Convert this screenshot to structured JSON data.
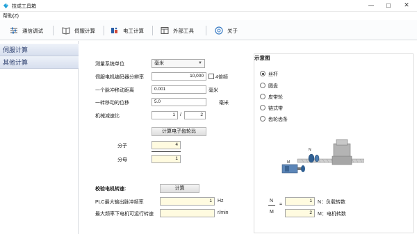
{
  "window": {
    "title": "技成工具箱",
    "min_glyph": "—",
    "max_glyph": "☐",
    "close_glyph": "✕"
  },
  "menu": {
    "help": "帮助(Z)"
  },
  "toolbar": {
    "items": [
      {
        "label": "通信调试",
        "icon": "sliders-icon"
      },
      {
        "label": "伺服计算",
        "icon": "book-icon"
      },
      {
        "label": "电工计算",
        "icon": "electrician-icon"
      },
      {
        "label": "外部工具",
        "icon": "window-tools-icon"
      },
      {
        "label": "关于",
        "icon": "about-icon"
      }
    ]
  },
  "sidebar": {
    "items": [
      {
        "label": "伺服计算"
      },
      {
        "label": "其他计算"
      }
    ]
  },
  "form": {
    "unit_label": "测量系统单位",
    "unit_value": "毫米",
    "encoder_label": "伺服电机编码器分辨率",
    "encoder_value": "10,000",
    "quad_label": "4倍频",
    "pulse_move_label": "一个脉冲移动距离",
    "pulse_move_value": "0.001",
    "pulse_move_unit": "毫米",
    "turn_move_label": "一转移动的位移",
    "turn_move_value": "5.0",
    "turn_move_unit": "毫米",
    "reduction_label": "机械减速比",
    "reduction_num": "1",
    "reduction_slash": "/",
    "reduction_den": "2",
    "gear_button": "计算电子齿轮比",
    "numerator_label": "分子",
    "numerator_value": "4",
    "denominator_label": "分母",
    "denominator_value": "1"
  },
  "speed": {
    "title": "校验电机转速:",
    "calc_button": "计算",
    "plc_label": "PLC最大输出脉冲频率",
    "plc_value": "1",
    "plc_unit": "Hz",
    "max_speed_label": "最大频率下电机可运行转速",
    "max_speed_value": "",
    "max_speed_unit": "r/min"
  },
  "diagram": {
    "title": "示意图",
    "options": [
      {
        "label": "丝杆",
        "selected": true
      },
      {
        "label": "圆盘",
        "selected": false
      },
      {
        "label": "皮带轮",
        "selected": false
      },
      {
        "label": "链式带",
        "selected": false
      },
      {
        "label": "齿轮齿条",
        "selected": false
      }
    ],
    "label_n": "N",
    "label_m": "M",
    "ratio_n_symbol": "N",
    "ratio_m_symbol": "M",
    "ratio_eq": "=",
    "n_value": "1",
    "m_value": "2",
    "n_desc": "N：负载转数",
    "m_desc": "M：电机转数"
  }
}
